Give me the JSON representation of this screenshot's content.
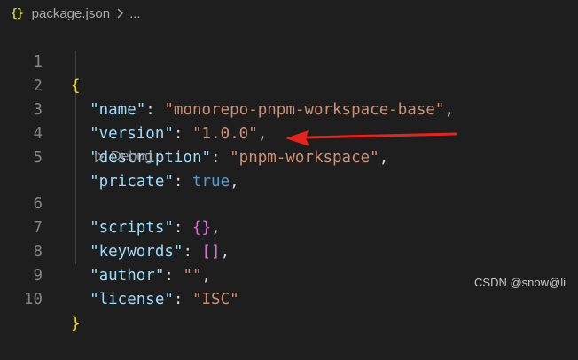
{
  "breadcrumb": {
    "icon": "{}",
    "file": "package.json",
    "more": "..."
  },
  "lines": [
    {
      "num": "1"
    },
    {
      "num": "2",
      "key": "\"name\"",
      "value": "\"monorepo-pnpm-workspace-base\""
    },
    {
      "num": "3",
      "key": "\"version\"",
      "value": "\"1.0.0\""
    },
    {
      "num": "4",
      "key": "\"description\"",
      "value": "\"pnpm-workspace\""
    },
    {
      "num": "5",
      "key": "\"pricate\"",
      "value": "true"
    },
    {
      "num": "6",
      "key": "\"scripts\"",
      "value": "{}"
    },
    {
      "num": "7",
      "key": "\"keywords\"",
      "value": "[]"
    },
    {
      "num": "8",
      "key": "\"author\"",
      "value": "\"\""
    },
    {
      "num": "9",
      "key": "\"license\"",
      "value": "\"ISC\""
    },
    {
      "num": "10"
    }
  ],
  "punct": {
    "open_brace": "{",
    "close_brace": "}",
    "colon": ": ",
    "comma": ","
  },
  "codelens": {
    "label": "Debug",
    "icon": "play-outline-icon"
  },
  "watermark": "CSDN @snow@li",
  "colors": {
    "background": "#1e1e1e",
    "key": "#9cdcfe",
    "string": "#ce9178",
    "boolean": "#569cd6",
    "bracket": "#ffd700",
    "inner_bracket": "#da70d6",
    "line_number": "#858585",
    "annotation_arrow": "#e8231a"
  }
}
